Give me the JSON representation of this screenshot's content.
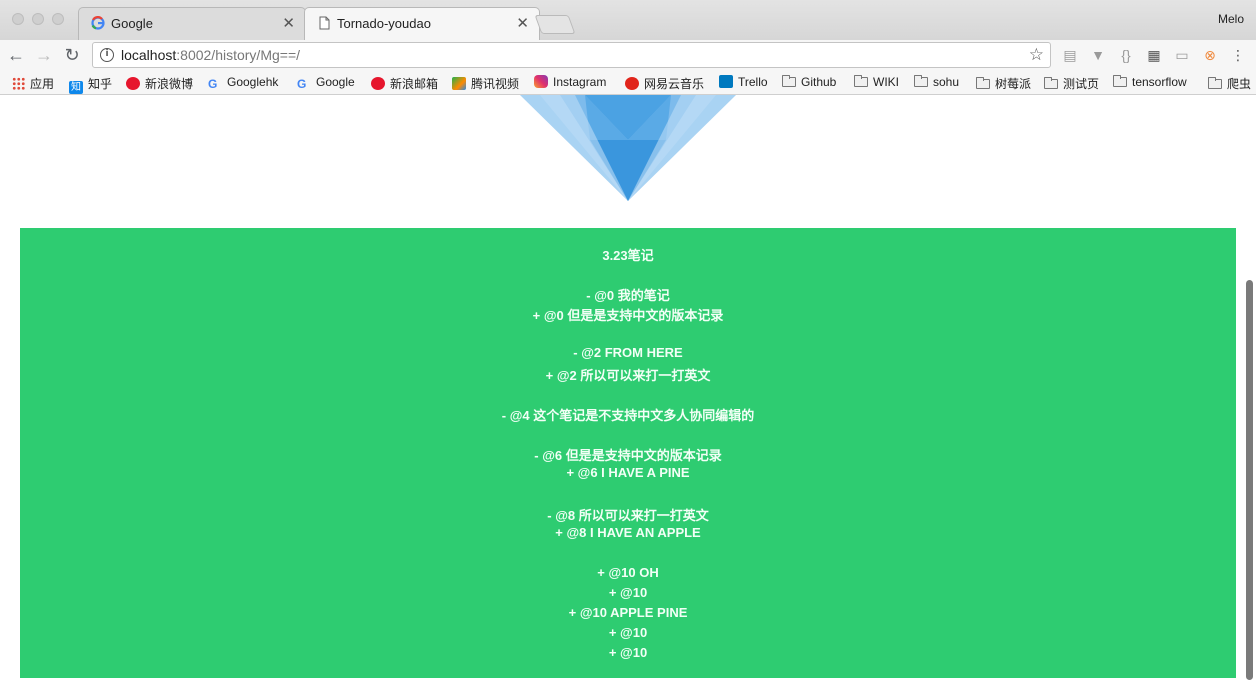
{
  "browser": {
    "tabs": [
      {
        "label": "Google"
      },
      {
        "label": "Tornado-youdao"
      }
    ],
    "profile": "Melo",
    "url": {
      "host": "localhost",
      "rest": ":8002/history/Mg==/"
    },
    "bookmarks": [
      {
        "label": "应用",
        "icon": "apps-grid-icon"
      },
      {
        "label": "知乎",
        "icon": "zhihu-icon"
      },
      {
        "label": "新浪微博",
        "icon": "weibo-icon"
      },
      {
        "label": "Googlehk",
        "icon": "google-icon"
      },
      {
        "label": "Google",
        "icon": "google-icon"
      },
      {
        "label": "新浪邮箱",
        "icon": "weibo-icon"
      },
      {
        "label": "腾讯视频",
        "icon": "tencent-video-icon"
      },
      {
        "label": "Instagram",
        "icon": "instagram-icon"
      },
      {
        "label": "网易云音乐",
        "icon": "netease-music-icon"
      },
      {
        "label": "Trello",
        "icon": "trello-icon"
      },
      {
        "label": "Github",
        "icon": "folder-icon"
      },
      {
        "label": "WIKI",
        "icon": "folder-icon"
      },
      {
        "label": "sohu",
        "icon": "folder-icon"
      },
      {
        "label": "树莓派",
        "icon": "folder-icon"
      },
      {
        "label": "测试页",
        "icon": "folder-icon"
      },
      {
        "label": "tensorflow",
        "icon": "folder-icon"
      },
      {
        "label": "爬虫",
        "icon": "folder-icon"
      }
    ]
  },
  "note": {
    "title": "3.23笔记",
    "lines": [
      "- @0 我的笔记",
      "+ @0 但是是支持中文的版本记录",
      "",
      "- @2 FROM HERE",
      "+ @2 所以可以来打一打英文",
      "",
      "- @4 这个笔记是不支持中文多人协同编辑的",
      "",
      "- @6 但是是支持中文的版本记录",
      "+ @6 I HAVE A PINE",
      "",
      "- @8 所以可以来打一打英文",
      "+ @8 I HAVE AN APPLE",
      "",
      "+ @10 OH",
      "+ @10",
      "+ @10 APPLE PINE",
      "+ @10",
      "+ @10"
    ]
  },
  "colors": {
    "note_background": "#2ecc71",
    "logo_blue": "#3a96dd"
  }
}
